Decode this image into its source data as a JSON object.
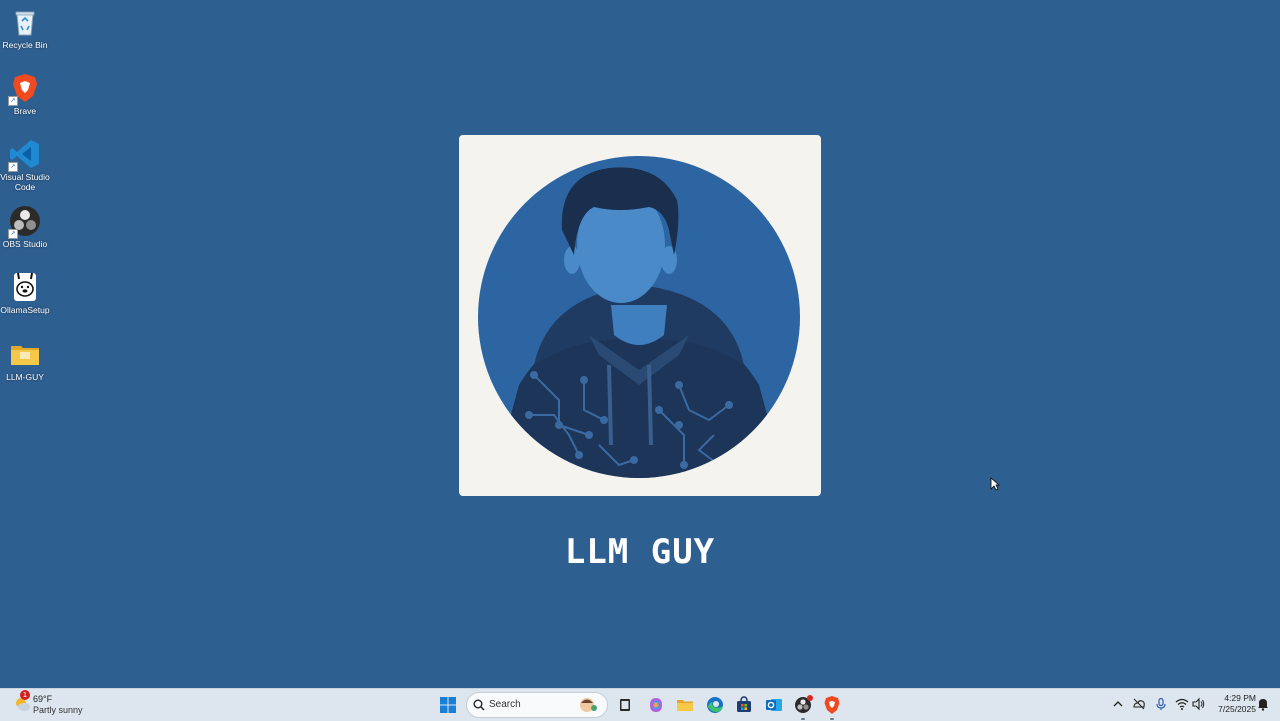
{
  "desktop": {
    "icons": [
      {
        "label": "Recycle Bin",
        "icon": "recycle-bin-icon"
      },
      {
        "label": "Brave",
        "icon": "brave-icon"
      },
      {
        "label": "Visual Studio Code",
        "icon": "vscode-icon"
      },
      {
        "label": "OBS Studio",
        "icon": "obs-icon"
      },
      {
        "label": "OllamaSetup",
        "icon": "ollama-icon"
      },
      {
        "label": "LLM-GUY",
        "icon": "folder-icon"
      }
    ]
  },
  "wallpaper": {
    "brand_text": "LLM GUY",
    "background_color": "#2e5f91",
    "card_color": "#f4f3ee"
  },
  "taskbar": {
    "weather": {
      "temp": "69°F",
      "condition": "Partly sunny",
      "badge": "1"
    },
    "search_placeholder": "Search",
    "pinned": [
      "windows-start-icon",
      "task-view-icon",
      "copilot-icon",
      "file-explorer-icon",
      "edge-icon",
      "microsoft-store-icon",
      "outlook-icon",
      "obs-icon",
      "brave-icon"
    ],
    "clock": {
      "time": "4:29 PM",
      "date": "7/25/2025"
    }
  }
}
